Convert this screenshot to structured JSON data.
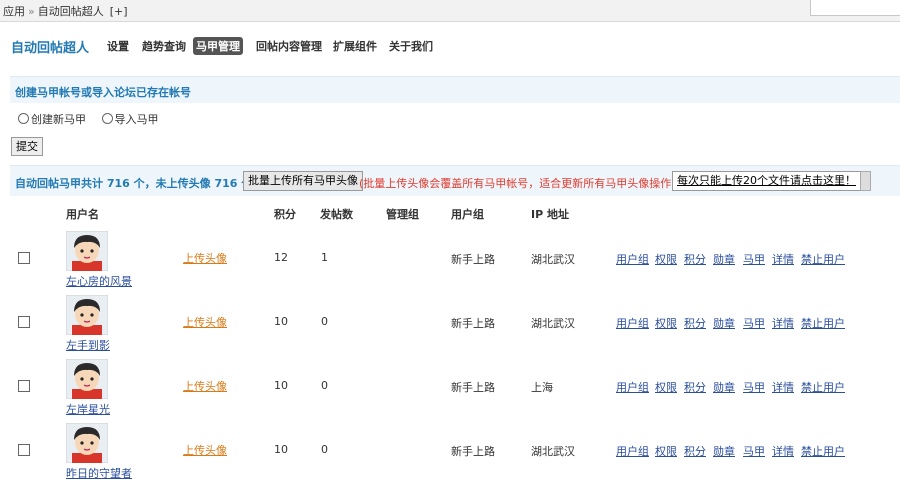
{
  "breadcrumb": {
    "root": "应用",
    "sep": "»",
    "current": "自动回帖超人",
    "add": "[+]"
  },
  "app": {
    "title": "自动回帖超人"
  },
  "nav": [
    {
      "label": "设置"
    },
    {
      "label": "趋势查询"
    },
    {
      "label": "马甲管理",
      "active": true
    },
    {
      "label": "回帖内容管理"
    },
    {
      "label": "扩展组件"
    },
    {
      "label": "关于我们"
    }
  ],
  "create_section": {
    "title": "创建马甲帐号或导入论坛已存在帐号",
    "options": [
      "创建新马甲",
      "导入马甲"
    ],
    "submit_label": "提交"
  },
  "stats": {
    "text": "自动回帖马甲共计 716 个，未上传头像 716 个",
    "bulk_upload_label": "批量上传所有马甲头像",
    "warning": "(批量上传头像会覆盖所有马甲帐号，适合更新所有马甲头像操作！)",
    "limit_label": "每次只能上传20个文件请点击这里！"
  },
  "table": {
    "headers": {
      "username": "用户名",
      "points": "积分",
      "posts": "发帖数",
      "admin_group": "管理组",
      "user_group": "用户组",
      "ip": "IP 地址"
    },
    "rows": [
      {
        "username": "左心房的风景",
        "upload": "上传头像",
        "points": "12",
        "posts": "1",
        "admin_group": "",
        "user_group": "新手上路",
        "ip": "湖北武汉"
      },
      {
        "username": "左手到影",
        "upload": "上传头像",
        "points": "10",
        "posts": "0",
        "admin_group": "",
        "user_group": "新手上路",
        "ip": "湖北武汉"
      },
      {
        "username": "左岸星光",
        "upload": "上传头像",
        "points": "10",
        "posts": "0",
        "admin_group": "",
        "user_group": "新手上路",
        "ip": "上海"
      },
      {
        "username": "昨日的守望者",
        "upload": "上传头像",
        "points": "10",
        "posts": "0",
        "admin_group": "",
        "user_group": "新手上路",
        "ip": "湖北武汉"
      }
    ],
    "actions": [
      "用户组",
      "权限",
      "积分",
      "勋章",
      "马甲",
      "详情",
      "禁止用户"
    ]
  },
  "colors": {
    "accent": "#2279b3",
    "warning": "#e23b2f",
    "upload_link": "#d87a16",
    "link": "#2b4e9d"
  }
}
